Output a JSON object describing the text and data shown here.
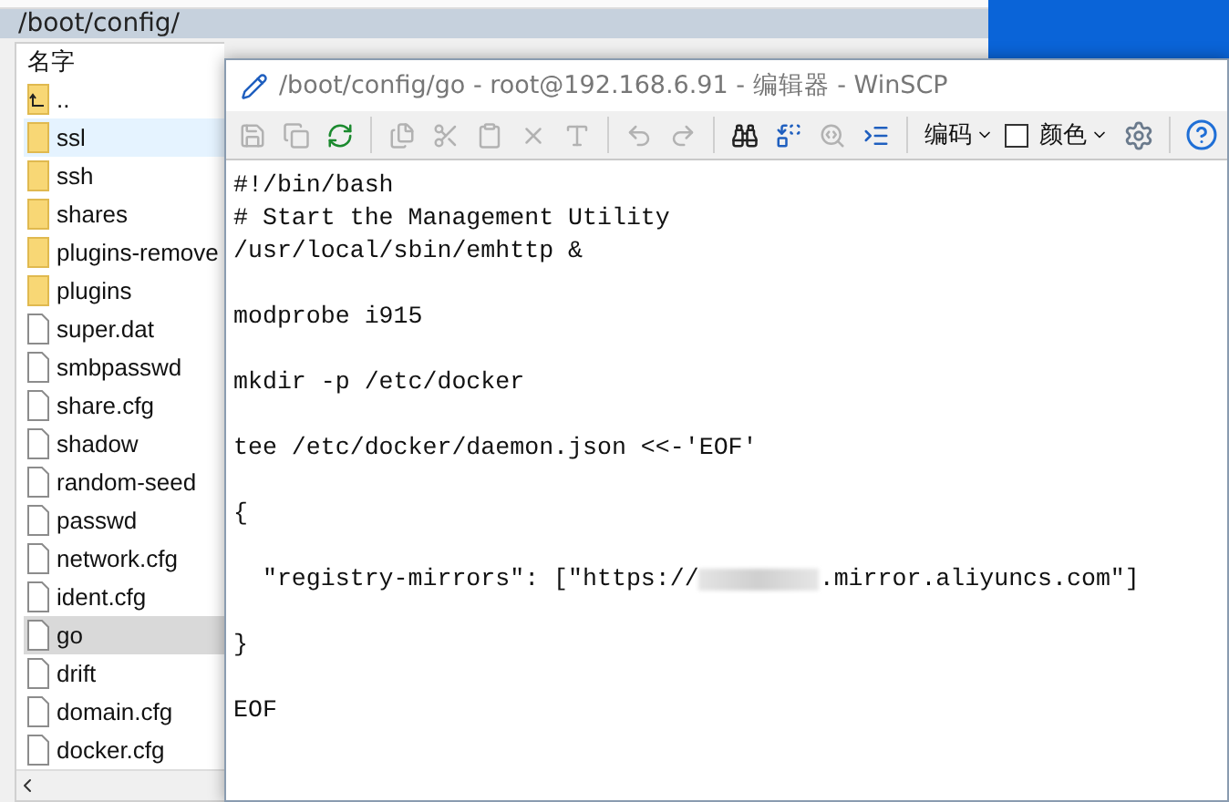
{
  "panel": {
    "path": "/boot/config/",
    "column_header": "名字",
    "files": [
      {
        "name": "..",
        "kind": "parent",
        "selected": false,
        "hovered": false
      },
      {
        "name": "ssl",
        "kind": "folder",
        "selected": false,
        "hovered": true
      },
      {
        "name": "ssh",
        "kind": "folder",
        "selected": false,
        "hovered": false
      },
      {
        "name": "shares",
        "kind": "folder",
        "selected": false,
        "hovered": false
      },
      {
        "name": "plugins-remove",
        "kind": "folder",
        "selected": false,
        "hovered": false
      },
      {
        "name": "plugins",
        "kind": "folder",
        "selected": false,
        "hovered": false
      },
      {
        "name": "super.dat",
        "kind": "file",
        "selected": false,
        "hovered": false
      },
      {
        "name": "smbpasswd",
        "kind": "file",
        "selected": false,
        "hovered": false
      },
      {
        "name": "share.cfg",
        "kind": "file",
        "selected": false,
        "hovered": false
      },
      {
        "name": "shadow",
        "kind": "file",
        "selected": false,
        "hovered": false
      },
      {
        "name": "random-seed",
        "kind": "file",
        "selected": false,
        "hovered": false
      },
      {
        "name": "passwd",
        "kind": "file",
        "selected": false,
        "hovered": false
      },
      {
        "name": "network.cfg",
        "kind": "file",
        "selected": false,
        "hovered": false
      },
      {
        "name": "ident.cfg",
        "kind": "file",
        "selected": false,
        "hovered": false
      },
      {
        "name": "go",
        "kind": "file",
        "selected": true,
        "hovered": false
      },
      {
        "name": "drift",
        "kind": "file",
        "selected": false,
        "hovered": false
      },
      {
        "name": "domain.cfg",
        "kind": "file",
        "selected": false,
        "hovered": false
      },
      {
        "name": "docker.cfg",
        "kind": "file",
        "selected": false,
        "hovered": false
      }
    ]
  },
  "editor": {
    "title": "/boot/config/go - root@192.168.6.91 - 编辑器 - WinSCP",
    "toolbar": [
      {
        "disabled": true
      },
      {
        "disabled": true
      },
      {
        "disabled": false
      },
      {
        "disabled": true
      },
      {
        "disabled": true
      },
      {
        "disabled": true
      },
      {
        "disabled": true
      },
      {
        "disabled": true
      },
      {
        "disabled": true
      },
      {
        "disabled": true
      },
      {
        "disabled": false
      },
      {
        "disabled": false
      },
      {
        "disabled": true
      },
      {
        "disabled": false
      },
      {
        "disabled": false
      }
    ],
    "encoding_menu": {
      "label": "编码"
    },
    "color_toggle": {
      "label": "颜色",
      "checked": false
    },
    "lines": [
      {
        "kind": "text",
        "text": "#!/bin/bash"
      },
      {
        "kind": "text",
        "text": "# Start the Management Utility"
      },
      {
        "kind": "text",
        "text": "/usr/local/sbin/emhttp &"
      },
      {
        "kind": "blank"
      },
      {
        "kind": "text",
        "text": "modprobe i915"
      },
      {
        "kind": "blank"
      },
      {
        "kind": "text",
        "text": "mkdir -p /etc/docker"
      },
      {
        "kind": "blank"
      },
      {
        "kind": "text",
        "text": "tee /etc/docker/daemon.json <<-'EOF'"
      },
      {
        "kind": "blank"
      },
      {
        "kind": "text",
        "text": "{"
      },
      {
        "kind": "blank"
      },
      {
        "kind": "redacted",
        "before": "  \"registry-mirrors\": [\"https://",
        "after": ".mirror.aliyuncs.com\"]"
      },
      {
        "kind": "blank"
      },
      {
        "kind": "text",
        "text": "}"
      },
      {
        "kind": "blank"
      },
      {
        "kind": "text",
        "text": "EOF"
      }
    ]
  }
}
